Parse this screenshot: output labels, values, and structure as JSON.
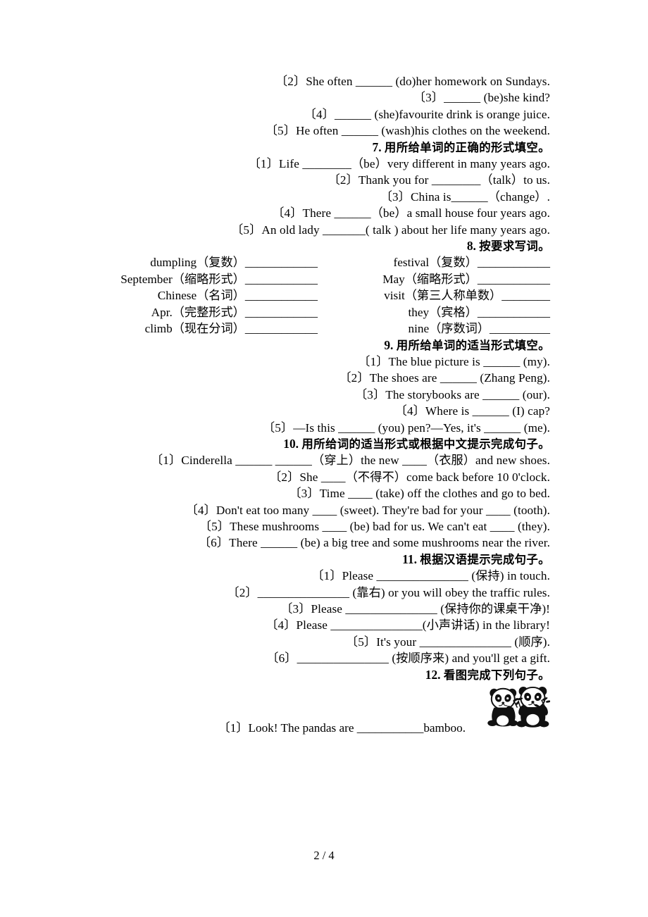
{
  "document": {
    "type": "english-exercise-worksheet",
    "page_footer": "2 / 4"
  },
  "continued_section": {
    "items": [
      "〔2〕She often ______ (do)her homework on Sundays.",
      "〔3〕______ (be)she kind?",
      "〔4〕______ (she)favourite drink is orange juice.",
      "〔5〕He often ______ (wash)his clothes on the weekend."
    ]
  },
  "sections": [
    {
      "number": "7.",
      "heading": "用所给单词的正确的形式填空。",
      "items": [
        "〔1〕Life ________（be）very different in many years ago.",
        "〔2〕Thank you for ________（talk）to us.",
        "〔3〕China is______（change）.",
        "〔4〕There ______（be）a small house four years ago.",
        "〔5〕An old lady _______( talk ) about her life many years ago."
      ]
    },
    {
      "number": "8.",
      "heading": "按要求写词。",
      "word_rows": [
        {
          "left": "dumpling（复数）____________",
          "right": "festival（复数）____________"
        },
        {
          "left": "September（缩略形式）____________",
          "right": "May（缩略形式）____________"
        },
        {
          "left": "Chinese（名词）____________",
          "right": "visit（第三人称单数）________"
        },
        {
          "left": "Apr.（完整形式）____________",
          "right": "they（宾格）____________"
        },
        {
          "left": "climb（现在分词）____________",
          "right": "nine（序数词）__________"
        }
      ]
    },
    {
      "number": "9.",
      "heading": "用所给单词的适当形式填空。",
      "items": [
        "〔1〕The blue picture is ______ (my).",
        "〔2〕The shoes are ______ (Zhang Peng).",
        "〔3〕The storybooks are ______ (our).",
        "〔4〕Where is ______ (I) cap?",
        "〔5〕—Is this ______ (you) pen?—Yes, it's ______ (me)."
      ]
    },
    {
      "number": "10.",
      "heading": "用所给词的适当形式或根据中文提示完成句子。",
      "items": [
        "〔1〕Cinderella ______ ______（穿上）the new ____（衣服）and new shoes.",
        "〔2〕She ____（不得不）come back before 10 0'clock.",
        "〔3〕Time ____ (take) off the clothes and go to bed.",
        "〔4〕Don't eat too many ____ (sweet). They're bad for your ____ (tooth).",
        "〔5〕These mushrooms ____ (be) bad for us. We can't eat ____ (they).",
        "〔6〕There ______ (be) a big tree and some mushrooms near the river."
      ]
    },
    {
      "number": "11.",
      "heading": "根据汉语提示完成句子。",
      "items": [
        "〔1〕Please _______________ (保持) in touch.",
        "〔2〕_______________ (靠右) or you will obey the traffic rules.",
        "〔3〕Please _______________ (保持你的课桌干净)!",
        "〔4〕Please _______________(小声讲话) in the library!",
        "〔5〕It's your _______________ (顺序).",
        "〔6〕_______________ (按顺序来) and you'll get a gift."
      ]
    },
    {
      "number": "12.",
      "heading": "看图完成下列句子。",
      "image_alt": "two-pandas-eating-bamboo",
      "items": [
        "〔1〕Look! The pandas are ___________bamboo."
      ]
    }
  ]
}
